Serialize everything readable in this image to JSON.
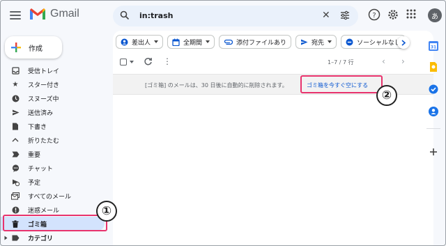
{
  "header": {
    "app_name": "Gmail",
    "search_query": "in:trash",
    "avatar_initial": "あ"
  },
  "sidebar": {
    "compose_label": "作成",
    "items": [
      {
        "label": "受信トレイ",
        "icon": "inbox-icon"
      },
      {
        "label": "スター付き",
        "icon": "star-icon"
      },
      {
        "label": "スヌーズ中",
        "icon": "clock-icon"
      },
      {
        "label": "送信済み",
        "icon": "send-icon"
      },
      {
        "label": "下書き",
        "icon": "draft-icon"
      },
      {
        "label": "折りたたむ",
        "icon": "chevron-up-icon"
      },
      {
        "label": "重要",
        "icon": "important-icon"
      },
      {
        "label": "チャット",
        "icon": "chat-icon"
      },
      {
        "label": "予定",
        "icon": "scheduled-icon"
      },
      {
        "label": "すべてのメール",
        "icon": "all-mail-icon"
      },
      {
        "label": "迷惑メール",
        "icon": "spam-icon"
      },
      {
        "label": "ゴミ箱",
        "icon": "trash-icon"
      },
      {
        "label": "カテゴリ",
        "icon": "label-icon"
      }
    ]
  },
  "filters": {
    "chips": [
      {
        "label": "差出人",
        "icon": "person-icon"
      },
      {
        "label": "全期間",
        "icon": "calendar-icon"
      },
      {
        "label": "添付ファイルあり",
        "icon": "attachment-icon"
      },
      {
        "label": "宛先",
        "icon": "send-icon"
      },
      {
        "label": "ソーシャルなし",
        "icon": "minus-circle-icon"
      }
    ]
  },
  "toolbar": {
    "pager_text": "1–7 / 7 行"
  },
  "banner": {
    "text": "[ゴミ箱] のメールは、30 日後に自動的に削除されます。",
    "link": "ゴミ箱を今すぐ空にする"
  },
  "annotations": {
    "step1": "①",
    "step2": "②"
  },
  "colors": {
    "accent_blue": "#0b57d0",
    "highlight_pink": "#e8336d",
    "active_nav": "#d3e3fd"
  }
}
